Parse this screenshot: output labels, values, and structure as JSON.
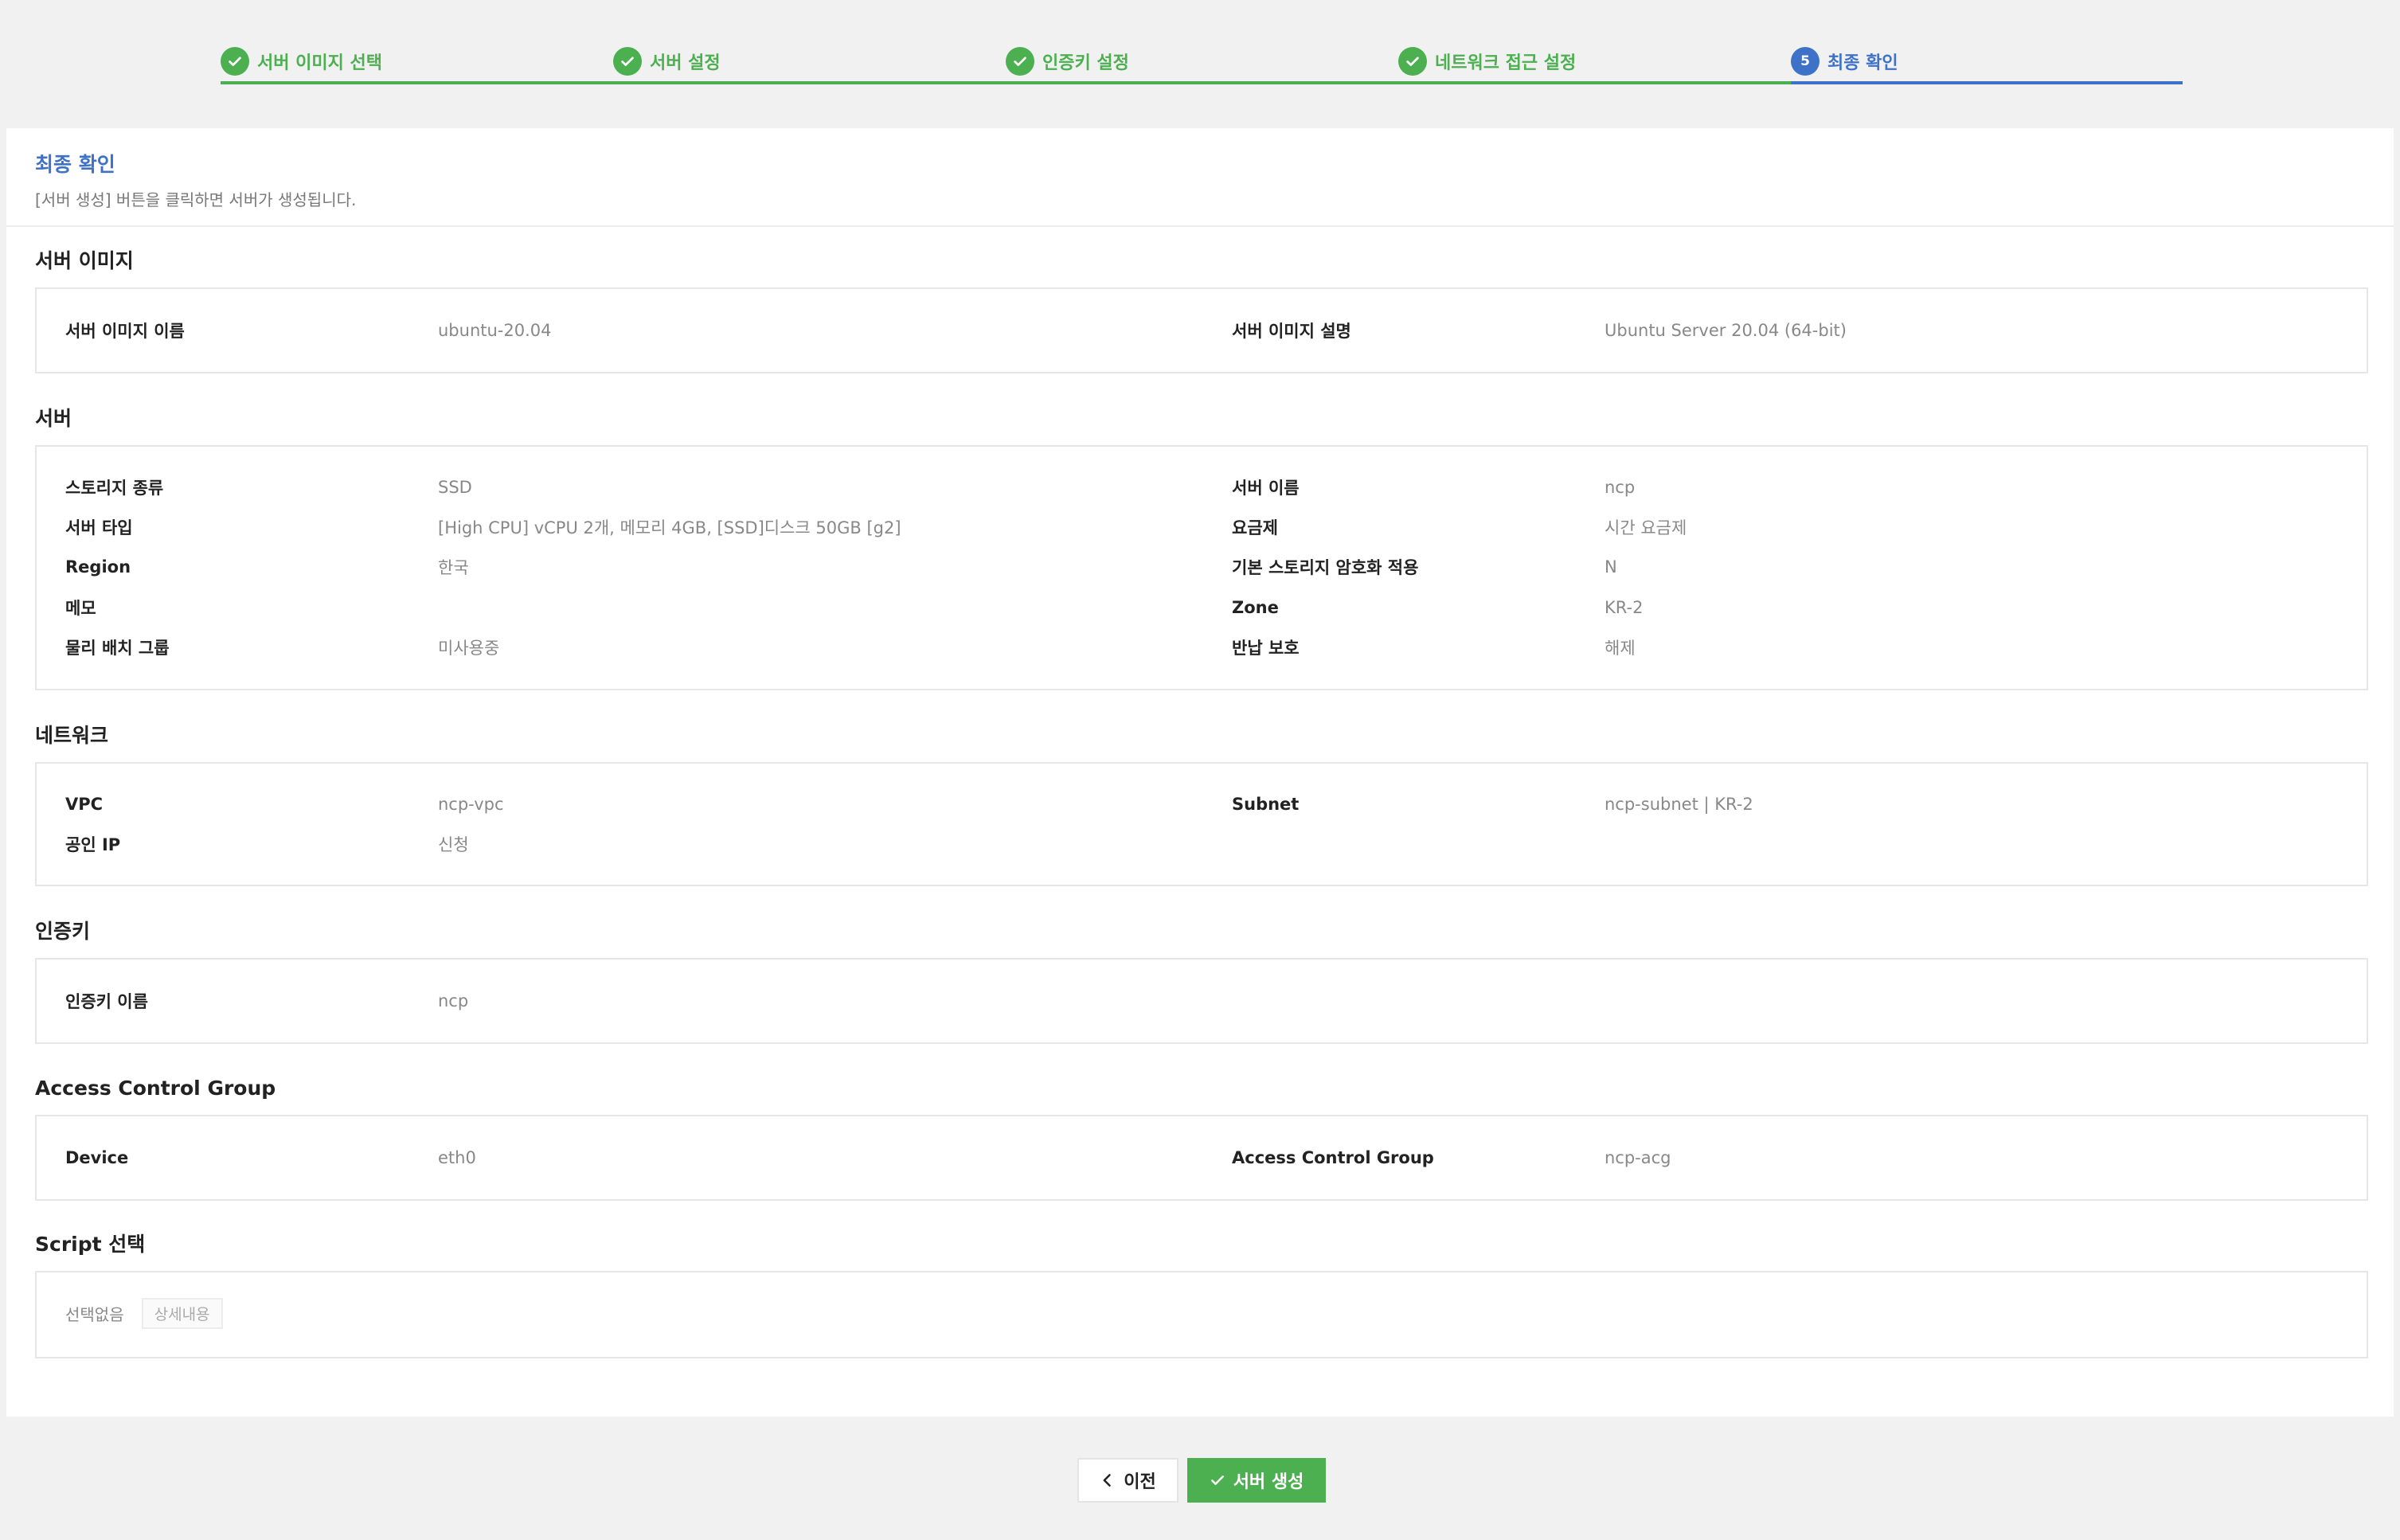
{
  "stepper": {
    "steps": [
      {
        "label": "서버 이미지 선택",
        "status": "done"
      },
      {
        "label": "서버 설정",
        "status": "done"
      },
      {
        "label": "인증키 설정",
        "status": "done"
      },
      {
        "label": "네트워크 접근 설정",
        "status": "done"
      },
      {
        "label": "최종 확인",
        "status": "active",
        "number": "5"
      }
    ]
  },
  "header": {
    "title": "최종 확인",
    "description": "[서버 생성] 버튼을 클릭하면 서버가 생성됩니다."
  },
  "sections": {
    "server_image": {
      "title": "서버 이미지",
      "name_label": "서버 이미지 이름",
      "name_value": "ubuntu-20.04",
      "desc_label": "서버 이미지 설명",
      "desc_value": "Ubuntu Server 20.04 (64-bit)"
    },
    "server": {
      "title": "서버",
      "storage_type_label": "스토리지 종류",
      "storage_type_value": "SSD",
      "server_name_label": "서버 이름",
      "server_name_value": "ncp",
      "server_type_label": "서버 타입",
      "server_type_value": "[High CPU] vCPU 2개, 메모리 4GB, [SSD]디스크 50GB [g2]",
      "plan_label": "요금제",
      "plan_value": "시간 요금제",
      "region_label": "Region",
      "region_value": "한국",
      "encryption_label": "기본 스토리지 암호화 적용",
      "encryption_value": "N",
      "memo_label": "메모",
      "memo_value": "",
      "zone_label": "Zone",
      "zone_value": "KR-2",
      "placement_label": "물리 배치 그룹",
      "placement_value": "미사용중",
      "return_protect_label": "반납 보호",
      "return_protect_value": "해제"
    },
    "network": {
      "title": "네트워크",
      "vpc_label": "VPC",
      "vpc_value": "ncp-vpc",
      "subnet_label": "Subnet",
      "subnet_value": "ncp-subnet | KR-2",
      "public_ip_label": "공인 IP",
      "public_ip_value": "신청"
    },
    "auth_key": {
      "title": "인증키",
      "name_label": "인증키 이름",
      "name_value": "ncp"
    },
    "acg": {
      "title": "Access Control Group",
      "device_label": "Device",
      "device_value": "eth0",
      "acg_label": "Access Control Group",
      "acg_value": "ncp-acg"
    },
    "script": {
      "title": "Script 선택",
      "none_text": "선택없음",
      "detail_button": "상세내용"
    }
  },
  "footer": {
    "prev_label": "이전",
    "create_label": "서버 생성"
  },
  "colors": {
    "done": "#4caf50",
    "active": "#3d72c8",
    "primary_button": "#4caf50"
  }
}
